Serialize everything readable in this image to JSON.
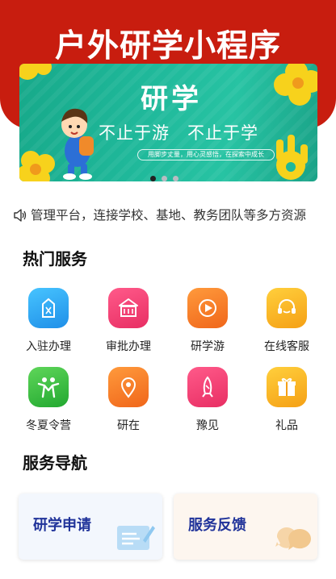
{
  "header": {
    "title": "户外研学小程序",
    "bg_color": "#c81d0f"
  },
  "banner": {
    "title": "研学",
    "subtitle": "不止于游　不止于学",
    "caption": "用脚步丈量，用心灵感悟，在探索中成长",
    "slides": 3,
    "active_slide": 1
  },
  "notice": {
    "icon": "speaker-icon",
    "text": "管理平台，连接学校、基地、教务团队等多方资源"
  },
  "hot_services": {
    "title": "热门服务",
    "items": [
      {
        "label": "入驻办理",
        "icon": "settle-in-icon",
        "color": "#2aa8f0"
      },
      {
        "label": "审批办理",
        "icon": "approval-building-icon",
        "color": "#f03c72"
      },
      {
        "label": "研学游",
        "icon": "study-tour-play-icon",
        "color": "#f47a22"
      },
      {
        "label": "在线客服",
        "icon": "customer-service-icon",
        "color": "#f7b21a"
      },
      {
        "label": "冬夏令营",
        "icon": "camp-people-icon",
        "color": "#3cbf3c"
      },
      {
        "label": "研在",
        "icon": "location-pin-icon",
        "color": "#f47a22"
      },
      {
        "label": "豫见",
        "icon": "rocket-icon",
        "color": "#f03c72"
      },
      {
        "label": "礼品",
        "icon": "gift-icon",
        "color": "#f7b21a"
      }
    ]
  },
  "service_nav": {
    "title": "服务导航",
    "cards": [
      {
        "label": "研学申请",
        "icon": "form-card-icon",
        "bg": "#f3f7fd"
      },
      {
        "label": "服务反馈",
        "icon": "feedback-bubble-icon",
        "bg": "#fdf6ef"
      }
    ]
  }
}
